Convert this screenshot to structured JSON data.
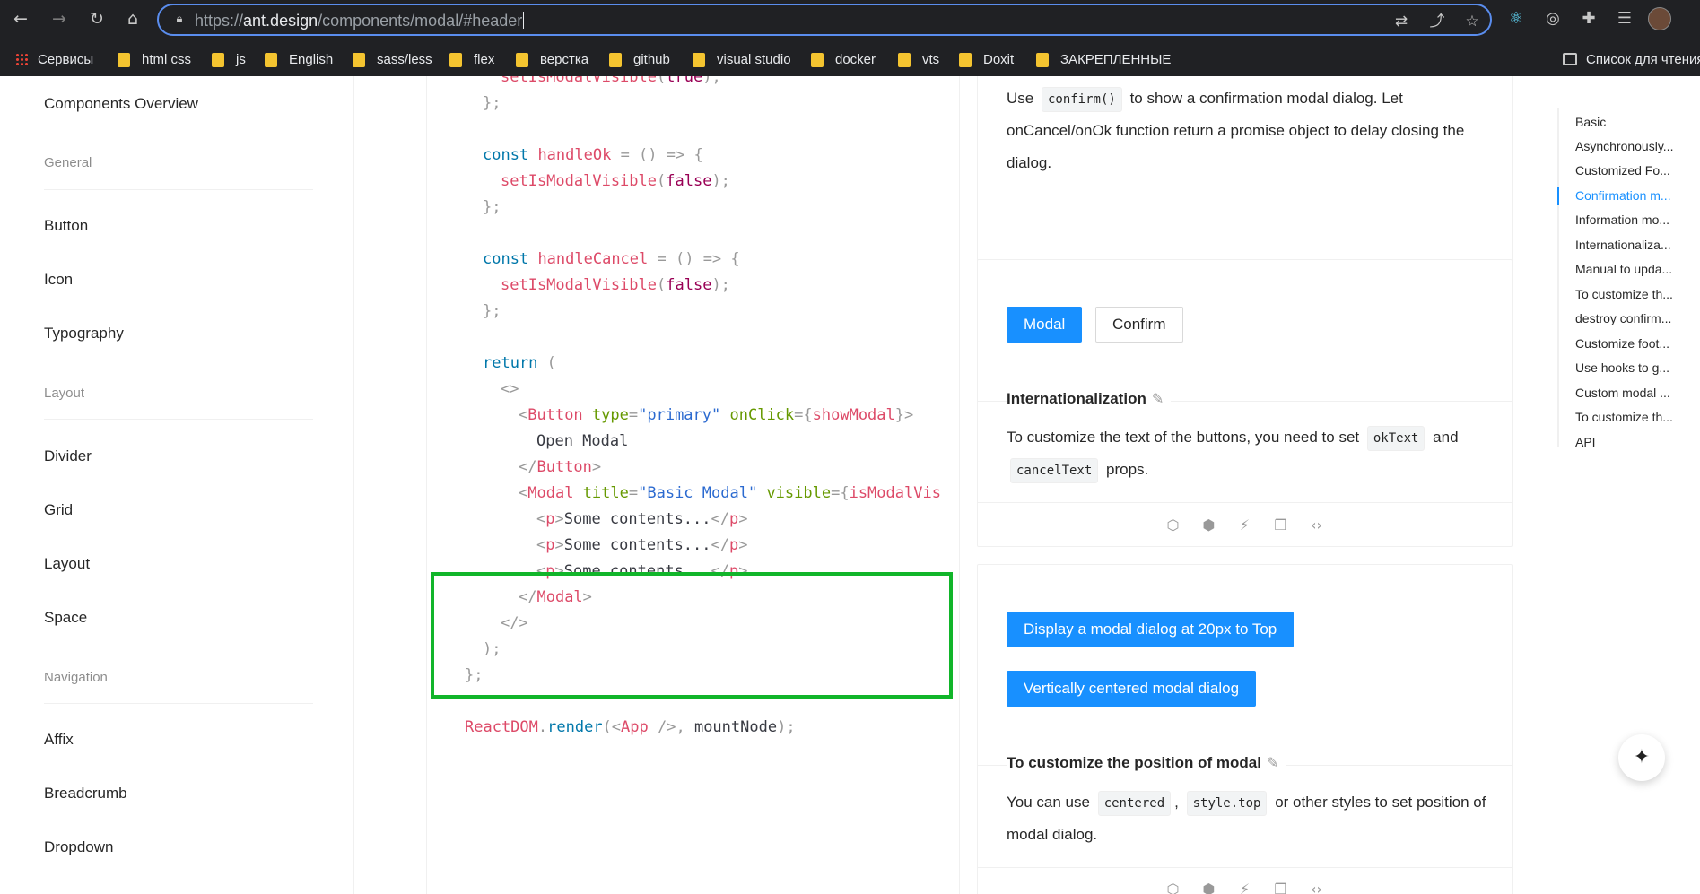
{
  "browser": {
    "url_prefix": "https://",
    "url_host": "ant.design",
    "url_path": "/components/modal/#header",
    "bookmarks": [
      "Сервисы",
      "html css",
      "js",
      "English",
      "sass/less",
      "flex",
      "верстка",
      "github",
      "visual studio",
      "docker",
      "vts",
      "Doxit",
      "ЗАКРЕПЛЕННЫЕ"
    ],
    "reading_list": "Список для чтения"
  },
  "sidebar": {
    "overview": "Components Overview",
    "groups": {
      "general": "General",
      "layout": "Layout",
      "navigation": "Navigation"
    },
    "items": {
      "button": "Button",
      "icon": "Icon",
      "typography": "Typography",
      "divider": "Divider",
      "grid": "Grid",
      "layout": "Layout",
      "space": "Space",
      "affix": "Affix",
      "breadcrumb": "Breadcrumb",
      "dropdown": "Dropdown"
    }
  },
  "code": {
    "l1_fn": "setIsModalVisible",
    "l1_arg": "true",
    "close_brace": "};",
    "const_kw": "const",
    "handle_ok": "handleOk",
    "handle_cancel": "handleCancel",
    "arrow": "= () => {",
    "set_fn": "setIsModalVisible",
    "false_val": "false",
    "return_kw": "return",
    "open_paren": "(",
    "fragment_open": "<>",
    "button_tag": "Button",
    "attr_type": "type",
    "val_primary": "\"primary\"",
    "attr_onclick": "onClick",
    "val_showmodal": "showModal",
    "open_modal_text": "Open Modal",
    "modal_tag": "Modal",
    "attr_title": "title",
    "val_basic_modal": "\"Basic Modal\"",
    "attr_visible": "visible",
    "val_is_modal_vis": "isModalVis",
    "p_tag": "p",
    "some_contents": "Some contents...",
    "fragment_close": "</>",
    "close_paren": ");",
    "reactdom": "ReactDOM",
    "render": "render",
    "app_tag": "App",
    "mount_node": "mountNode"
  },
  "cards": {
    "confirm_desc": {
      "use": "Use",
      "code": "confirm()",
      "rest": "to show a confirmation modal dialog. Let onCancel/onOk function return a promise object to delay closing the dialog."
    },
    "i18n": {
      "btn_modal": "Modal",
      "btn_confirm": "Confirm",
      "title": "Internationalization",
      "desc_a": "To customize the text of the buttons, you need to set",
      "code1": "okText",
      "and": "and",
      "code2": "cancelText",
      "props": "props."
    },
    "position": {
      "btn_top": "Display a modal dialog at 20px to Top",
      "btn_center": "Vertically centered modal dialog",
      "title": "To customize the position of modal",
      "desc_a": "You can use",
      "code1": "centered",
      "comma": ",",
      "code2": "style.top",
      "desc_b": "or other styles to set position of modal dialog."
    }
  },
  "toc": [
    "Basic",
    "Asynchronously...",
    "Customized Fo...",
    "Confirmation m...",
    "Information mo...",
    "Internationaliza...",
    "Manual to upda...",
    "To customize th...",
    "destroy confirm...",
    "Customize foot...",
    "Use hooks to g...",
    "Custom modal ...",
    "To customize th...",
    "API"
  ],
  "toc_active_index": 3,
  "colors": {
    "primary": "#1890ff",
    "highlight_border": "#11b52a"
  }
}
